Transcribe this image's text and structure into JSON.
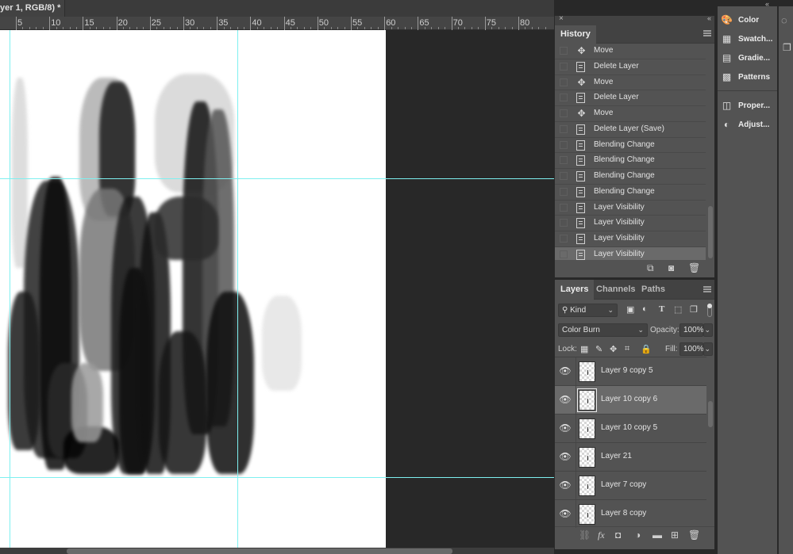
{
  "document": {
    "tab_title": "yer 1, RGB/8) *"
  },
  "ruler": {
    "labels": [
      "5",
      "10",
      "15",
      "20",
      "25",
      "30",
      "35",
      "40",
      "45",
      "50",
      "55",
      "60",
      "65",
      "70",
      "75",
      "80"
    ]
  },
  "history": {
    "close_glyph": "×",
    "collapse_glyph": "«",
    "tab_label": "History",
    "items": [
      {
        "icon": "move",
        "label": "Move"
      },
      {
        "icon": "doc",
        "label": "Delete Layer"
      },
      {
        "icon": "move",
        "label": "Move"
      },
      {
        "icon": "doc",
        "label": "Delete Layer"
      },
      {
        "icon": "move",
        "label": "Move"
      },
      {
        "icon": "doc",
        "label": "Delete Layer (Save)"
      },
      {
        "icon": "doc",
        "label": "Blending Change"
      },
      {
        "icon": "doc",
        "label": "Blending Change"
      },
      {
        "icon": "doc",
        "label": "Blending Change"
      },
      {
        "icon": "doc",
        "label": "Blending Change"
      },
      {
        "icon": "doc",
        "label": "Layer Visibility"
      },
      {
        "icon": "doc",
        "label": "Layer Visibility"
      },
      {
        "icon": "doc",
        "label": "Layer Visibility"
      },
      {
        "icon": "doc",
        "label": "Layer Visibility",
        "selected": true
      }
    ],
    "footer_icons": [
      "new-document-from-state-icon",
      "snapshot-camera-icon",
      "trash-icon"
    ]
  },
  "layers": {
    "tabs": [
      "Layers",
      "Channels",
      "Paths"
    ],
    "active_tab": "Layers",
    "filter": {
      "kind_label": "Kind"
    },
    "blend_mode": "Color Burn",
    "opacity_label": "Opacity:",
    "opacity_value": "100%",
    "lock_label": "Lock:",
    "fill_label": "Fill:",
    "fill_value": "100%",
    "items": [
      {
        "name": "Layer 9 copy 5",
        "visible": true
      },
      {
        "name": "Layer 10 copy 6",
        "visible": true,
        "selected": true
      },
      {
        "name": "Layer 10 copy 5",
        "visible": true
      },
      {
        "name": "Layer 21",
        "visible": true
      },
      {
        "name": "Layer 7 copy",
        "visible": true
      },
      {
        "name": "Layer 8 copy",
        "visible": true
      }
    ]
  },
  "dock": {
    "collapse_glyph": "«",
    "items": [
      {
        "icon": "palette-icon",
        "label": "Color"
      },
      {
        "icon": "swatches-icon",
        "label": "Swatch..."
      },
      {
        "icon": "gradient-icon",
        "label": "Gradie..."
      },
      {
        "icon": "patterns-icon",
        "label": "Patterns"
      },
      {
        "icon": "properties-icon",
        "label": "Proper..."
      },
      {
        "icon": "adjustments-icon",
        "label": "Adjust..."
      }
    ]
  }
}
